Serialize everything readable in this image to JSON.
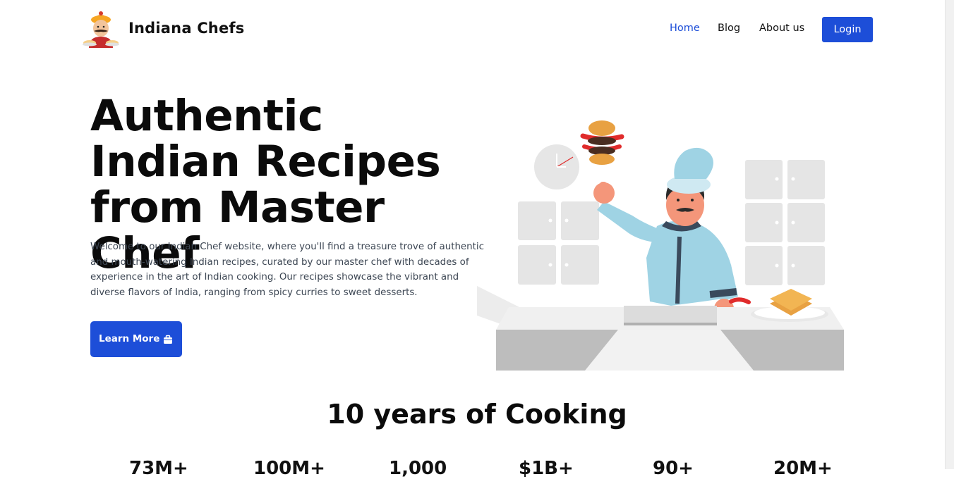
{
  "brand": {
    "name": "Indiana Chefs"
  },
  "nav": {
    "links": [
      {
        "label": "Home",
        "active": true
      },
      {
        "label": "Blog",
        "active": false
      },
      {
        "label": "About us",
        "active": false
      }
    ],
    "login_label": "Login"
  },
  "hero": {
    "title": "Authentic Indian Recipes from Master Chef",
    "description": "Welcome to our Indian Chef website, where you'll find a treasure trove of authentic and mouth-watering Indian recipes, curated by our master chef with decades of experience in the art of Indian cooking. Our recipes showcase the vibrant and diverse flavors of India, ranging from spicy curries to sweet desserts.",
    "button_label": "Learn More",
    "button_icon": "briefcase-icon"
  },
  "stats_section": {
    "title": "10 years of Cooking",
    "stats": [
      "73M+",
      "100M+",
      "1,000",
      "$1B+",
      "90+",
      "20M+"
    ]
  },
  "colors": {
    "accent": "#1d4ed8",
    "text": "#111111",
    "muted_text": "#3c4653",
    "chef_coat": "#9fd3e4",
    "cabinet": "#e5e5e5",
    "counter": "#bdbdbd"
  }
}
